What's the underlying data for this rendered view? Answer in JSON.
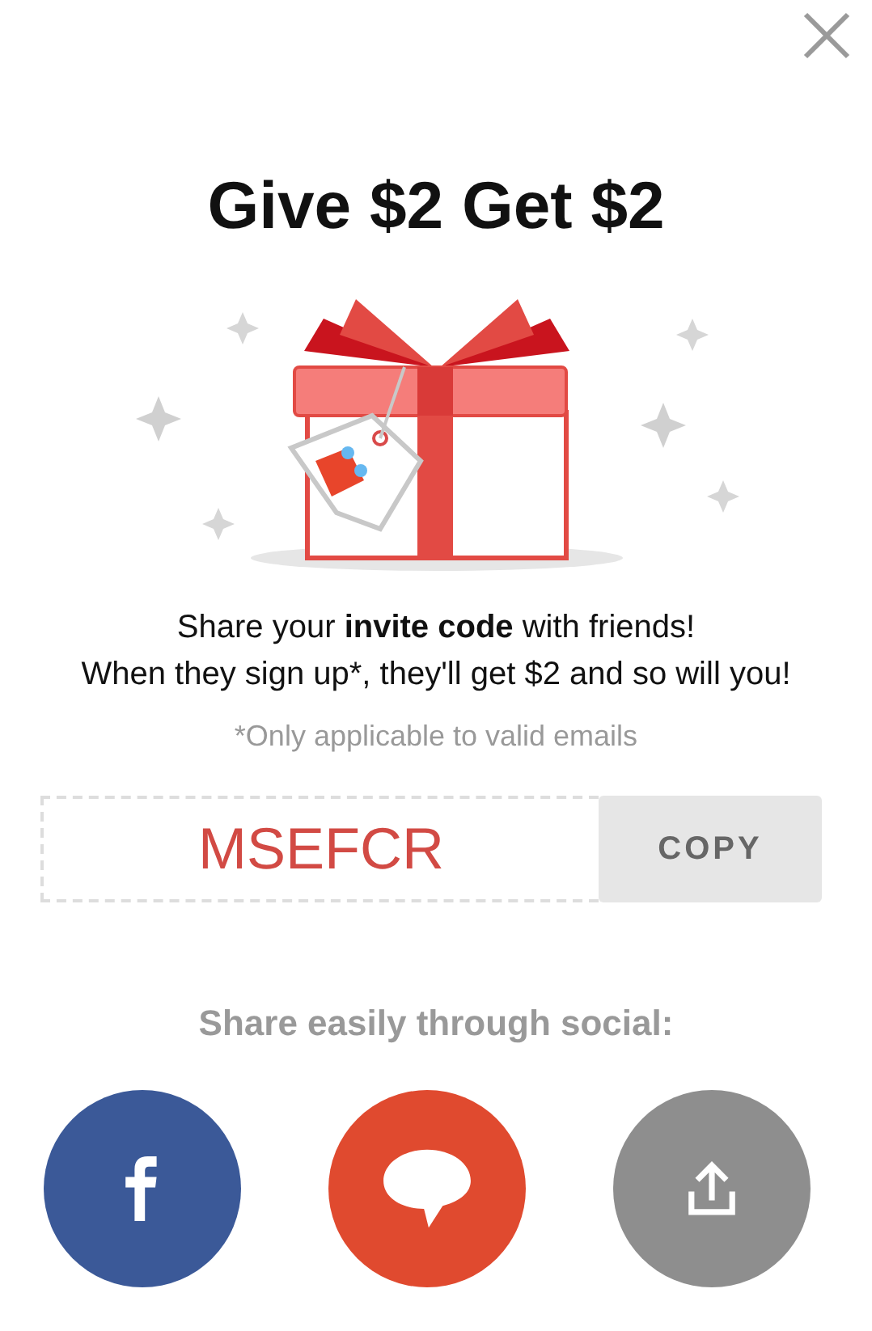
{
  "title": "Give $2 Get $2",
  "intro": [
    "Share your **invite code** with friends!",
    "When they sign up*, they'll get $2 and so will you!"
  ],
  "note": "*Only applicable to valid emails",
  "invite_code": "MSEFCR",
  "copy_button": "COPY",
  "social_heading": "Share easily through social:",
  "social_buttons": [
    {
      "kind": "facebook",
      "color": "#3b5998"
    },
    {
      "kind": "message",
      "color": "#e04a2f"
    },
    {
      "kind": "share",
      "color": "#8e8e8e"
    }
  ]
}
